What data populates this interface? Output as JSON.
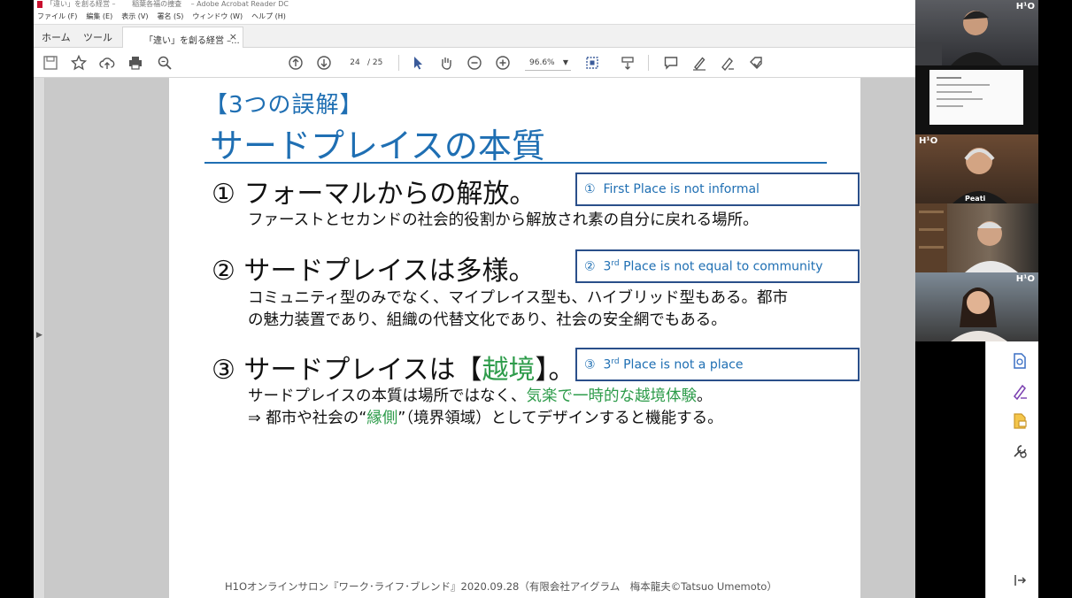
{
  "window": {
    "title": "「違い」を創る経営 –　　 稲葉各福の捜査　 – Adobe Acrobat Reader DC"
  },
  "menu": [
    "ファイル (F)",
    "編集 (E)",
    "表示 (V)",
    "署名 (S)",
    "ウィンドウ (W)",
    "ヘルプ (H)"
  ],
  "tabs": {
    "home": "ホーム",
    "tools": "ツール",
    "document": "「違い」を創る経営 –...",
    "close": "×"
  },
  "toolbar": {
    "page_current": "24",
    "page_total": "/ 25",
    "zoom": "96.6%"
  },
  "slide": {
    "subtitle": "【3つの誤解】",
    "title": "サードプレイスの本質",
    "points": [
      {
        "heading": "① フォーマルからの解放。",
        "desc_lines": [
          "ファーストとセカンドの社会的役割から解放され素の自分に戻れる場所。"
        ],
        "callout_num": "①",
        "callout_text": "First Place is not informal"
      },
      {
        "heading": "② サードプレイスは多様。",
        "desc_lines": [
          "コミュニティ型のみでなく、マイプレイス型も、ハイブリッド型もある。都市",
          "の魅力装置であり、組織の代替文化であり、社会の安全網でもある。"
        ],
        "callout_num": "②",
        "callout_sup": "rd",
        "callout_pre": "3",
        "callout_text": " Place is not equal to community"
      },
      {
        "heading_pre": "③ サードプレイスは【",
        "heading_green": "越境",
        "heading_post": "】。",
        "desc1_pre": "サードプレイスの本質は場所ではなく、",
        "desc1_green": "気楽で一時的な越境体験",
        "desc1_post": "。",
        "desc2_pre": "⇒ 都市や社会の“",
        "desc2_green": "縁側",
        "desc2_post": "”（境界領域）としてデザインすると機能する。",
        "callout_num": "③",
        "callout_sup": "rd",
        "callout_pre": "3",
        "callout_text": " Place is not a place"
      }
    ],
    "footer": "H1Oオンラインサロン『ワーク･ライフ･ブレンド』2020.09.28（有限会社アイグラム　梅本龍夫©Tatsuo Umemoto）"
  },
  "video": {
    "badge": "H¹O",
    "name_tag": "Peati"
  },
  "colors": {
    "accent_blue": "#1f6fb3",
    "callout_border": "#2a4f8a",
    "green": "#2e9c4b"
  }
}
